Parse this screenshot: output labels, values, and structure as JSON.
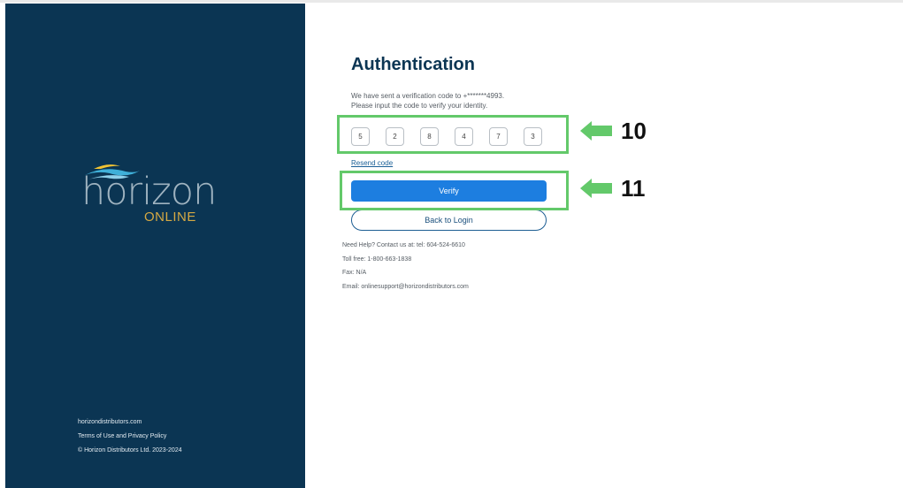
{
  "sidebar": {
    "logo": {
      "word": "horizon",
      "sub": "ONLINE"
    },
    "footer": {
      "site": "horizondistributors.com",
      "terms": "Terms of Use and Privacy Policy",
      "copyright": "© Horizon Distributors Ltd. 2023-2024"
    }
  },
  "auth": {
    "title": "Authentication",
    "message_line1": "We have sent a verification code to +*******4993.",
    "message_line2": "Please input the code to verify your identity.",
    "code_digits": [
      "5",
      "2",
      "8",
      "4",
      "7",
      "3"
    ],
    "resend_label": "Resend code",
    "verify_label": "Verify",
    "back_label": "Back to Login"
  },
  "help": {
    "line1": "Need Help? Contact us at: tel: 604-524-6610",
    "line2": "Toll free: 1-800-663-1838",
    "line3": "Fax: N/A",
    "line4": "Email: onlinesupport@horizondistributors.com"
  },
  "annotations": {
    "step_code": "10",
    "step_verify": "11"
  },
  "colors": {
    "sidebar_bg": "#0b3553",
    "accent_blue": "#1d7ee0",
    "highlight_green": "#63c96a",
    "logo_gold": "#d5a943"
  }
}
